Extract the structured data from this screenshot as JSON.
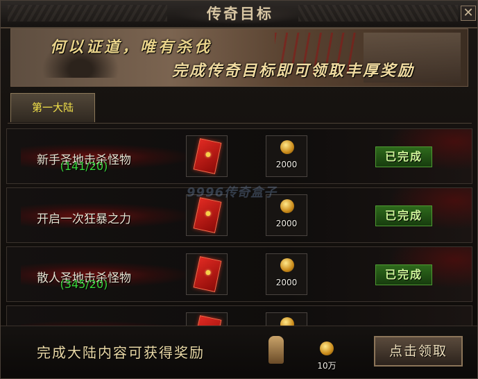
{
  "window": {
    "title": "传奇目标",
    "close_label": "✕"
  },
  "banner": {
    "line1": "何以证道，唯有杀伐",
    "line2": "完成传奇目标即可领取丰厚奖励"
  },
  "tabs": [
    {
      "label": "第一大陆",
      "active": true
    }
  ],
  "goals": [
    {
      "name": "新手圣地击杀怪物",
      "progress": "(141/20)",
      "item_icon": "red-envelope-icon",
      "gold": "2000",
      "status": "已完成"
    },
    {
      "name": "开启一次狂暴之力",
      "progress": "",
      "item_icon": "red-envelope-icon",
      "gold": "2000",
      "status": "已完成"
    },
    {
      "name": "散人圣地击杀怪物",
      "progress": "(345/20)",
      "item_icon": "red-envelope-icon",
      "gold": "2000",
      "status": "已完成"
    },
    {
      "name": "",
      "progress": "",
      "item_icon": "red-envelope-icon",
      "gold": "",
      "status": ""
    }
  ],
  "watermark": "9996传奇盒子",
  "footer": {
    "text": "完成大陆内容可获得奖励",
    "reward_gold": "10万",
    "claim_label": "点击领取"
  },
  "colors": {
    "progress_green": "#38d63c",
    "tab_yellow": "#f3e24a",
    "done_green": "#2e6a1c"
  }
}
